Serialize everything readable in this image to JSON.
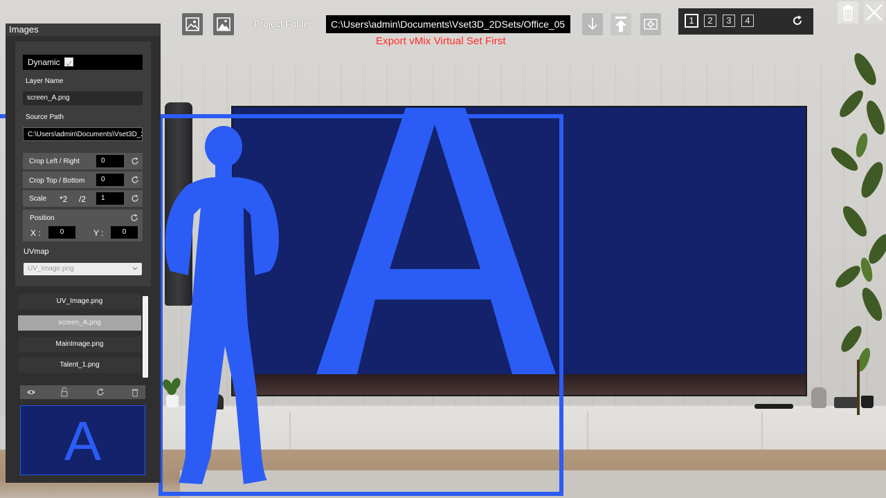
{
  "toolbar": {
    "add_image_icon": "image-icon",
    "add_image_alt_icon": "image-add-icon",
    "project_folder_label": "Project Folder :",
    "project_folder_value": "C:\\Users\\admin\\Documents\\Vset3D_2DSets/Office_05",
    "export_warning": "Export vMix Virtual Set First",
    "import_icon": "download-arrow-icon",
    "export_icon": "upload-arrow-icon",
    "settings_icon": "gear-icon"
  },
  "layouts": {
    "items": [
      "1",
      "2",
      "3",
      "4"
    ],
    "active": "1",
    "refresh_icon": "refresh-icon"
  },
  "window_controls": {
    "delete_icon": "trash-icon",
    "close_icon": "close-icon"
  },
  "panel": {
    "title": "Images",
    "dynamic_label": "Dynamic",
    "dynamic_checked": true,
    "layer_name_label": "Layer Name",
    "layer_name_value": "screen_A.png",
    "source_path_label": "Source Path",
    "source_path_value": "C:\\Users\\admin\\Documents\\Vset3D_2D",
    "crop_lr_label": "Crop Left / Right",
    "crop_lr_value": "0",
    "crop_tb_label": "Crop Top / Bottom",
    "crop_tb_value": "0",
    "scale_label": "Scale",
    "scale_double": "*2",
    "scale_half": "/2",
    "scale_value": "1",
    "position_label": "Position",
    "x_label": "X :",
    "x_value": "0",
    "y_label": "Y :",
    "y_value": "0",
    "uvmap_label": "UVmap",
    "uvmap_value": "UV_Image.png"
  },
  "image_list": {
    "items": [
      "UV_Image.png",
      "screen_A.png",
      "MainImage.png",
      "Talent_1.png"
    ],
    "selected": "screen_A.png"
  },
  "list_tools": [
    "eye-icon",
    "lock-open-icon",
    "refresh-icon",
    "trash-icon"
  ],
  "preview": {
    "letter": "A"
  },
  "scene": {
    "screen_letter": "A"
  },
  "colors": {
    "accent_blue": "#2b5cf5",
    "screen_navy": "#13226a",
    "warning_red": "#ff2a2a",
    "panel_bg": "#2f2f2f"
  }
}
